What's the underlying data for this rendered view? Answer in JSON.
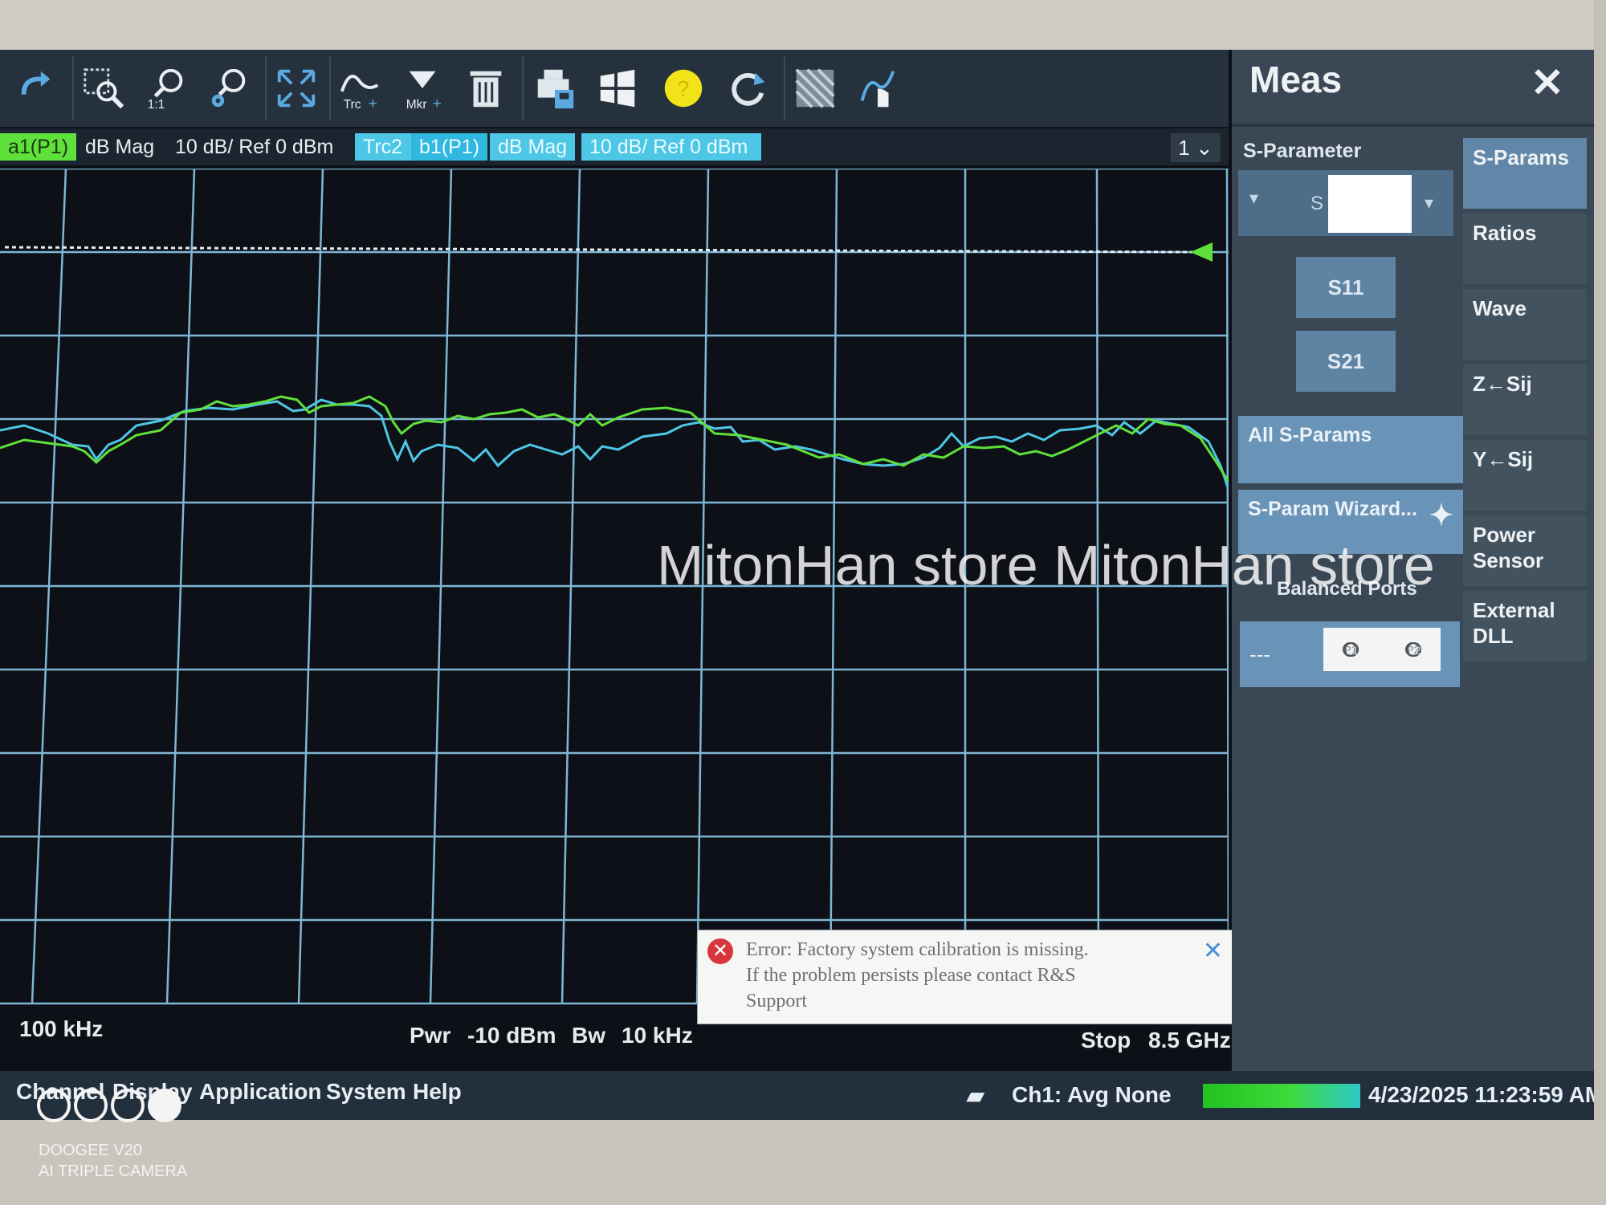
{
  "toolbar": {
    "tools": [
      {
        "name": "undo-icon"
      },
      {
        "name": "zoom-box-icon"
      },
      {
        "name": "zoom-1to1-icon",
        "label": "1:1"
      },
      {
        "name": "zoom-settings-icon"
      },
      {
        "name": "fullscreen-icon"
      },
      {
        "name": "add-trace-icon",
        "label": "Trc"
      },
      {
        "name": "add-marker-icon",
        "label": "Mkr"
      },
      {
        "name": "delete-icon"
      },
      {
        "name": "print-save-icon"
      },
      {
        "name": "windows-icon"
      },
      {
        "name": "help-icon",
        "label": "?"
      },
      {
        "name": "refresh-icon"
      },
      {
        "name": "screen-icon"
      },
      {
        "name": "touch-icon"
      }
    ]
  },
  "traces": {
    "trc1": {
      "meas": "a1(P1)",
      "format": "dB Mag",
      "scale": "10 dB/ Ref 0 dBm",
      "color": "#5fe03a"
    },
    "trc2": {
      "name": "Trc2",
      "meas": "b1(P1)",
      "format": "dB Mag",
      "scale": "10 dB/ Ref 0 dBm",
      "color": "#4ec6e6"
    },
    "channel_selector": "1"
  },
  "footer": {
    "start": "100 kHz",
    "pwr_label": "Pwr",
    "pwr_value": "-10 dBm",
    "bw_label": "Bw",
    "bw_value": "10 kHz",
    "stop_label": "Stop",
    "stop_value": "8.5 GHz"
  },
  "error": {
    "line1": "Error: Factory system calibration is missing.",
    "line2": "If the problem persists please contact R&S",
    "line3": "Support"
  },
  "statusbar": {
    "menus": [
      "Channel",
      "Display",
      "Application",
      "System",
      "Help"
    ],
    "channel_status": "Ch1: Avg None",
    "datetime": "4/23/2025 11:23:59 AM"
  },
  "meas_panel": {
    "title": "Meas",
    "section": "S-Parameter",
    "s_label": "S",
    "buttons": {
      "s11": "S11",
      "s21": "S21"
    },
    "all_sparams": "All S-Params",
    "wizard": "S-Param Wizard...",
    "balanced": "Balanced Ports",
    "port_dash": "---",
    "port_labels": [
      "P1",
      "P2"
    ],
    "port_lines": [
      "L1",
      "L2"
    ],
    "tabs": [
      "S-Params",
      "Ratios",
      "Wave",
      "Z←Sij",
      "Y←Sij",
      "Power Sensor",
      "External DLL"
    ]
  },
  "watermark": "MitonHan store MitonHan store",
  "camera": {
    "line1": "DOOGEE V20",
    "line2": "AI TRIPLE CAMERA"
  }
}
